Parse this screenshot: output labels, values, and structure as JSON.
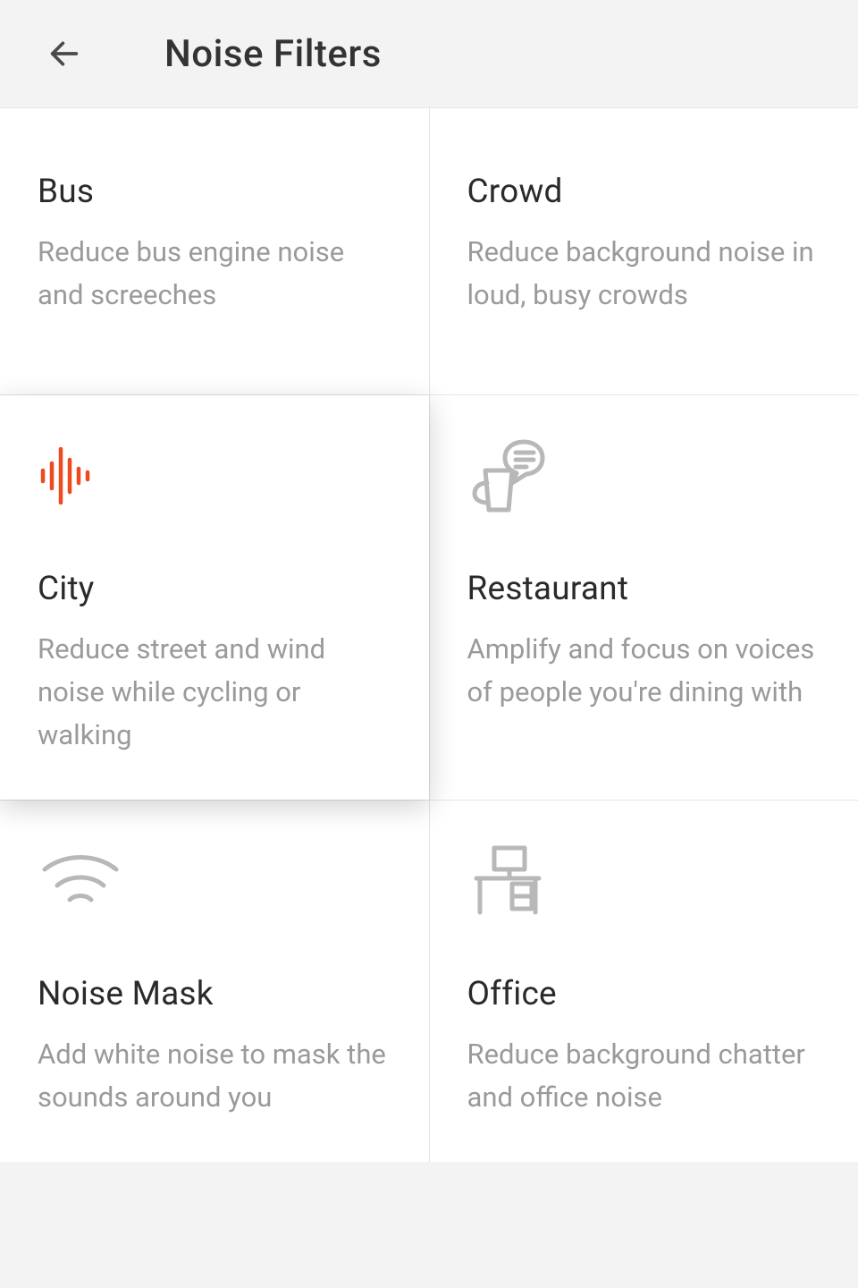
{
  "header": {
    "title": "Noise Filters"
  },
  "filters": [
    {
      "id": "bus",
      "title": "Bus",
      "description": "Reduce bus engine noise and screeches"
    },
    {
      "id": "crowd",
      "title": "Crowd",
      "description": "Reduce background noise in loud, busy crowds"
    },
    {
      "id": "city",
      "title": "City",
      "description": "Reduce street and wind noise while cycling or walking",
      "selected": true,
      "icon": "audio-wave-icon"
    },
    {
      "id": "restaurant",
      "title": "Restaurant",
      "description": "Amplify and focus on voices of people you're dining with",
      "icon": "cup-chat-icon"
    },
    {
      "id": "noise-mask",
      "title": "Noise Mask",
      "description": "Add white noise to mask the sounds around you",
      "icon": "wifi-waves-icon"
    },
    {
      "id": "office",
      "title": "Office",
      "description": "Reduce background chatter and office noise",
      "icon": "desk-icon"
    }
  ],
  "colors": {
    "accent": "#ed4a1f",
    "iconGray": "#b8b8b8"
  }
}
